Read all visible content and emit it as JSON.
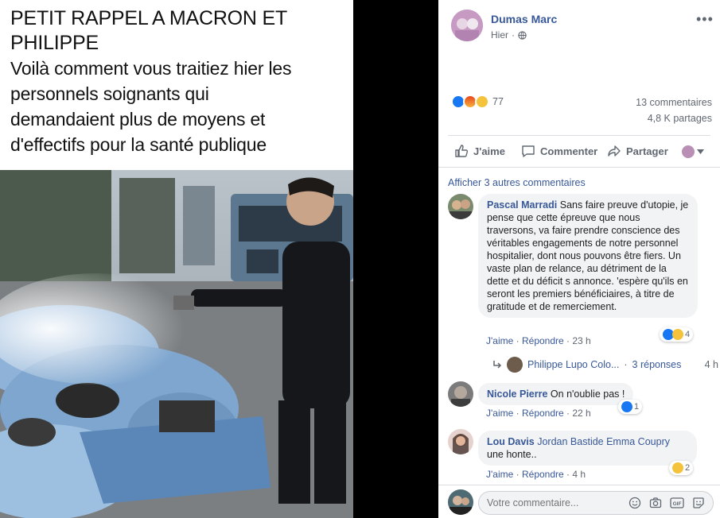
{
  "meme": {
    "line1": "PETIT RAPPEL A MACRON ET",
    "line2": "PHILIPPE",
    "line3": "Voilà comment vous traitiez hier les",
    "line4": "personnels soignants qui",
    "line5": "demandaient plus de moyens et",
    "line6": "d'effectifs pour la santé publique"
  },
  "post": {
    "author": "Dumas Marc",
    "time": "Hier",
    "reaction_count": "77",
    "comments_count": "13 commentaires",
    "shares_count": "4,8 K partages"
  },
  "actions": {
    "like": "J'aime",
    "comment": "Commenter",
    "share": "Partager"
  },
  "comments_section": {
    "show_more": "Afficher 3 autres commentaires",
    "like_label": "J'aime",
    "reply_label": "Répondre"
  },
  "comments": [
    {
      "name": "Pascal Marradi",
      "text": "Sans faire preuve d'utopie, je pense que cette épreuve que nous traversons, va faire prendre conscience des véritables engagements de notre personnel hospitalier, dont nous pouvons être fiers. Un vaste plan de relance, au détriment de la dette et du déficit s annonce. 'espère qu'ils en seront les premiers bénéficiaires, à titre de gratitude et de remerciement.",
      "time": "23 h",
      "reactions": "4"
    },
    {
      "name": "Nicole Pierre",
      "text": "On n'oublie pas !",
      "time": "22 h",
      "reactions": "1"
    },
    {
      "name": "Lou Davis",
      "tags": "Jordan Bastide Emma Coupry",
      "text": "une honte..",
      "time": "4 h",
      "reactions": "2"
    }
  ],
  "reply_row": {
    "name": "Philippe Lupo Colo...",
    "sep": "·",
    "replies": "3 réponses",
    "time": "4 h"
  },
  "composer": {
    "placeholder": "Votre commentaire..."
  }
}
